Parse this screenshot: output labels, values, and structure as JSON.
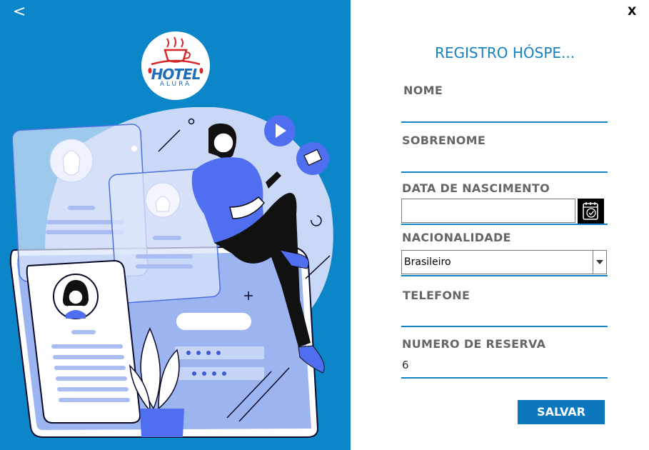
{
  "window": {
    "back_label": "<",
    "close_label": "X"
  },
  "logo": {
    "hotel": "HOTEL",
    "alura": "ALURA"
  },
  "form": {
    "title": "REGISTRO HÓSPE...",
    "fields": {
      "nome": {
        "label": "NOME",
        "value": ""
      },
      "sobrenome": {
        "label": "SOBRENOME",
        "value": ""
      },
      "data_nascimento": {
        "label": "DATA DE NASCIMENTO",
        "value": ""
      },
      "nacionalidade": {
        "label": "NACIONALIDADE",
        "value": "Brasileiro"
      },
      "telefone": {
        "label": "TELEFONE",
        "value": ""
      },
      "numero_reserva": {
        "label": "NUMERO DE RESERVA",
        "value": "6"
      }
    },
    "save_label": "SALVAR"
  },
  "icons": {
    "calendar": "calendar-check-icon",
    "dropdown": "chevron-down-icon",
    "play": "play-icon",
    "mail": "envelope-icon"
  },
  "colors": {
    "left_panel": "#0b87c9",
    "accent": "#1582c4",
    "button": "#0b78bd",
    "label": "#666666"
  }
}
